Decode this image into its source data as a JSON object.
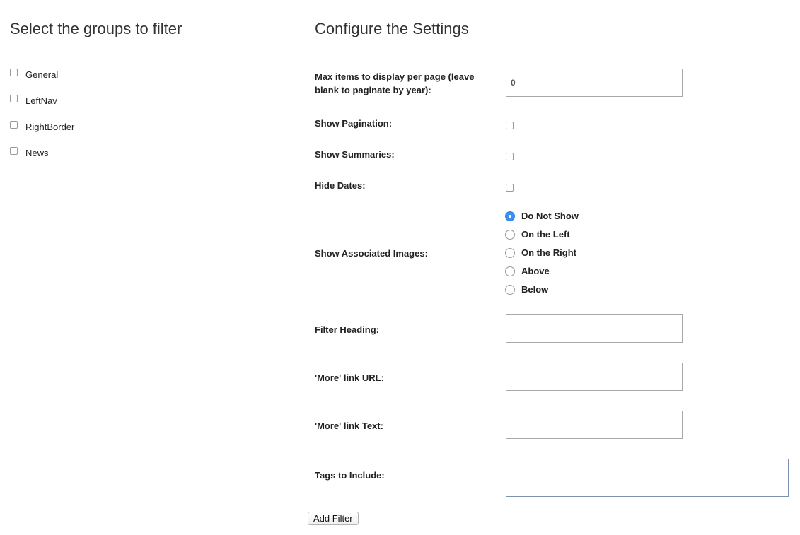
{
  "groups": {
    "title": "Select the groups to filter",
    "items": [
      {
        "label": "General",
        "checked": false
      },
      {
        "label": "LeftNav",
        "checked": false
      },
      {
        "label": "RightBorder",
        "checked": false
      },
      {
        "label": "News",
        "checked": false
      }
    ]
  },
  "settings": {
    "title": "Configure the Settings",
    "max_items": {
      "label": "Max items to display per page (leave blank to paginate by year):",
      "value": "0"
    },
    "show_pagination": {
      "label": "Show Pagination:",
      "checked": false
    },
    "show_summaries": {
      "label": "Show Summaries:",
      "checked": false
    },
    "hide_dates": {
      "label": "Hide Dates:",
      "checked": false
    },
    "associated_images": {
      "label": "Show Associated Images:",
      "selected": "Do Not Show",
      "options": [
        "Do Not Show",
        "On the Left",
        "On the Right",
        "Above",
        "Below"
      ]
    },
    "filter_heading": {
      "label": "Filter Heading:",
      "value": ""
    },
    "more_link_url": {
      "label": "'More' link URL:",
      "value": ""
    },
    "more_link_text": {
      "label": "'More' link Text:",
      "value": ""
    },
    "tags_to_include": {
      "label": "Tags to Include:",
      "value": ""
    }
  },
  "actions": {
    "add_filter_label": "Add Filter"
  },
  "colors": {
    "radio_selected": "#3d8ff0"
  }
}
